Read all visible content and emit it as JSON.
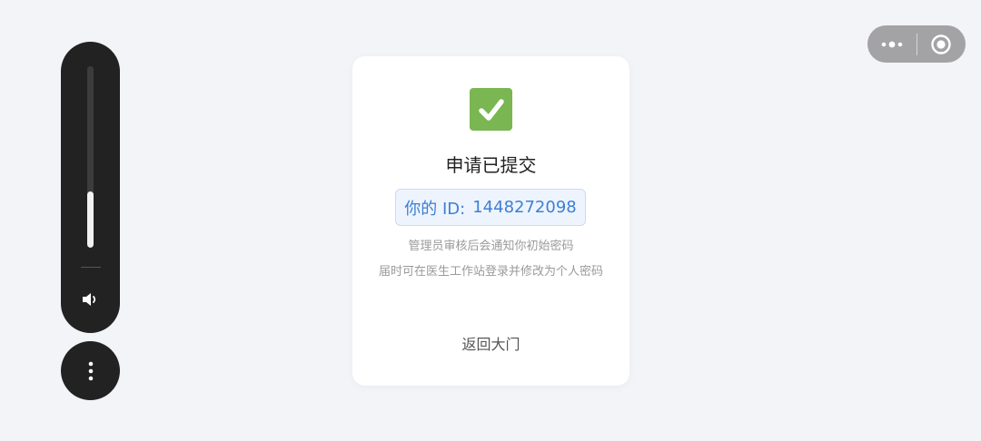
{
  "volume": {
    "level": 0.31
  },
  "icons": {
    "speaker": "speaker-icon",
    "more": "more-vertical-icon",
    "capsule_more": "more-horizontal-icon",
    "capsule_close": "target-icon",
    "check": "check-icon"
  },
  "card": {
    "title": "申请已提交",
    "id_label": "你的 ID:",
    "id_value": "1448272098",
    "note_line1": "管理员审核后会通知你初始密码",
    "note_line2": "届时可在医生工作站登录并修改为个人密码",
    "back_link": "返回大门"
  },
  "colors": {
    "check_green": "#7ab651",
    "id_blue": "#3d7fd3",
    "panel_dark": "#222222"
  }
}
